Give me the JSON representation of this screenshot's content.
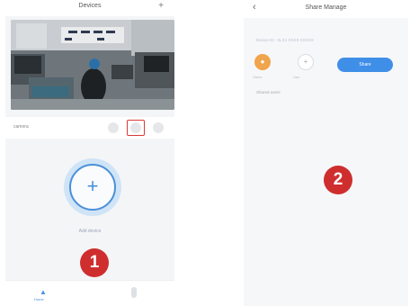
{
  "left_screen": {
    "header": {
      "title": "Devices",
      "add_icon": "plus-icon"
    },
    "preview": {
      "type": "camera-feed"
    },
    "toolbar": {
      "device_name": "camera"
    },
    "add_device": {
      "label": "Add device",
      "icon": "plus-icon",
      "accent": "#4a90d9"
    },
    "tabbar": {
      "home_label": "Home"
    },
    "badge": "1"
  },
  "right_screen": {
    "header": {
      "title": "Share Manage",
      "back_icon": "chevron-left-icon"
    },
    "device_line": "Device ID : XLX1 XXXX XXXXX",
    "share_button": "Share",
    "owner_label": "Owner",
    "user_label": "User",
    "section_label": "Shared users",
    "badge": "2"
  },
  "colors": {
    "badge": "#cf2e2e",
    "accent": "#4a90d9"
  }
}
